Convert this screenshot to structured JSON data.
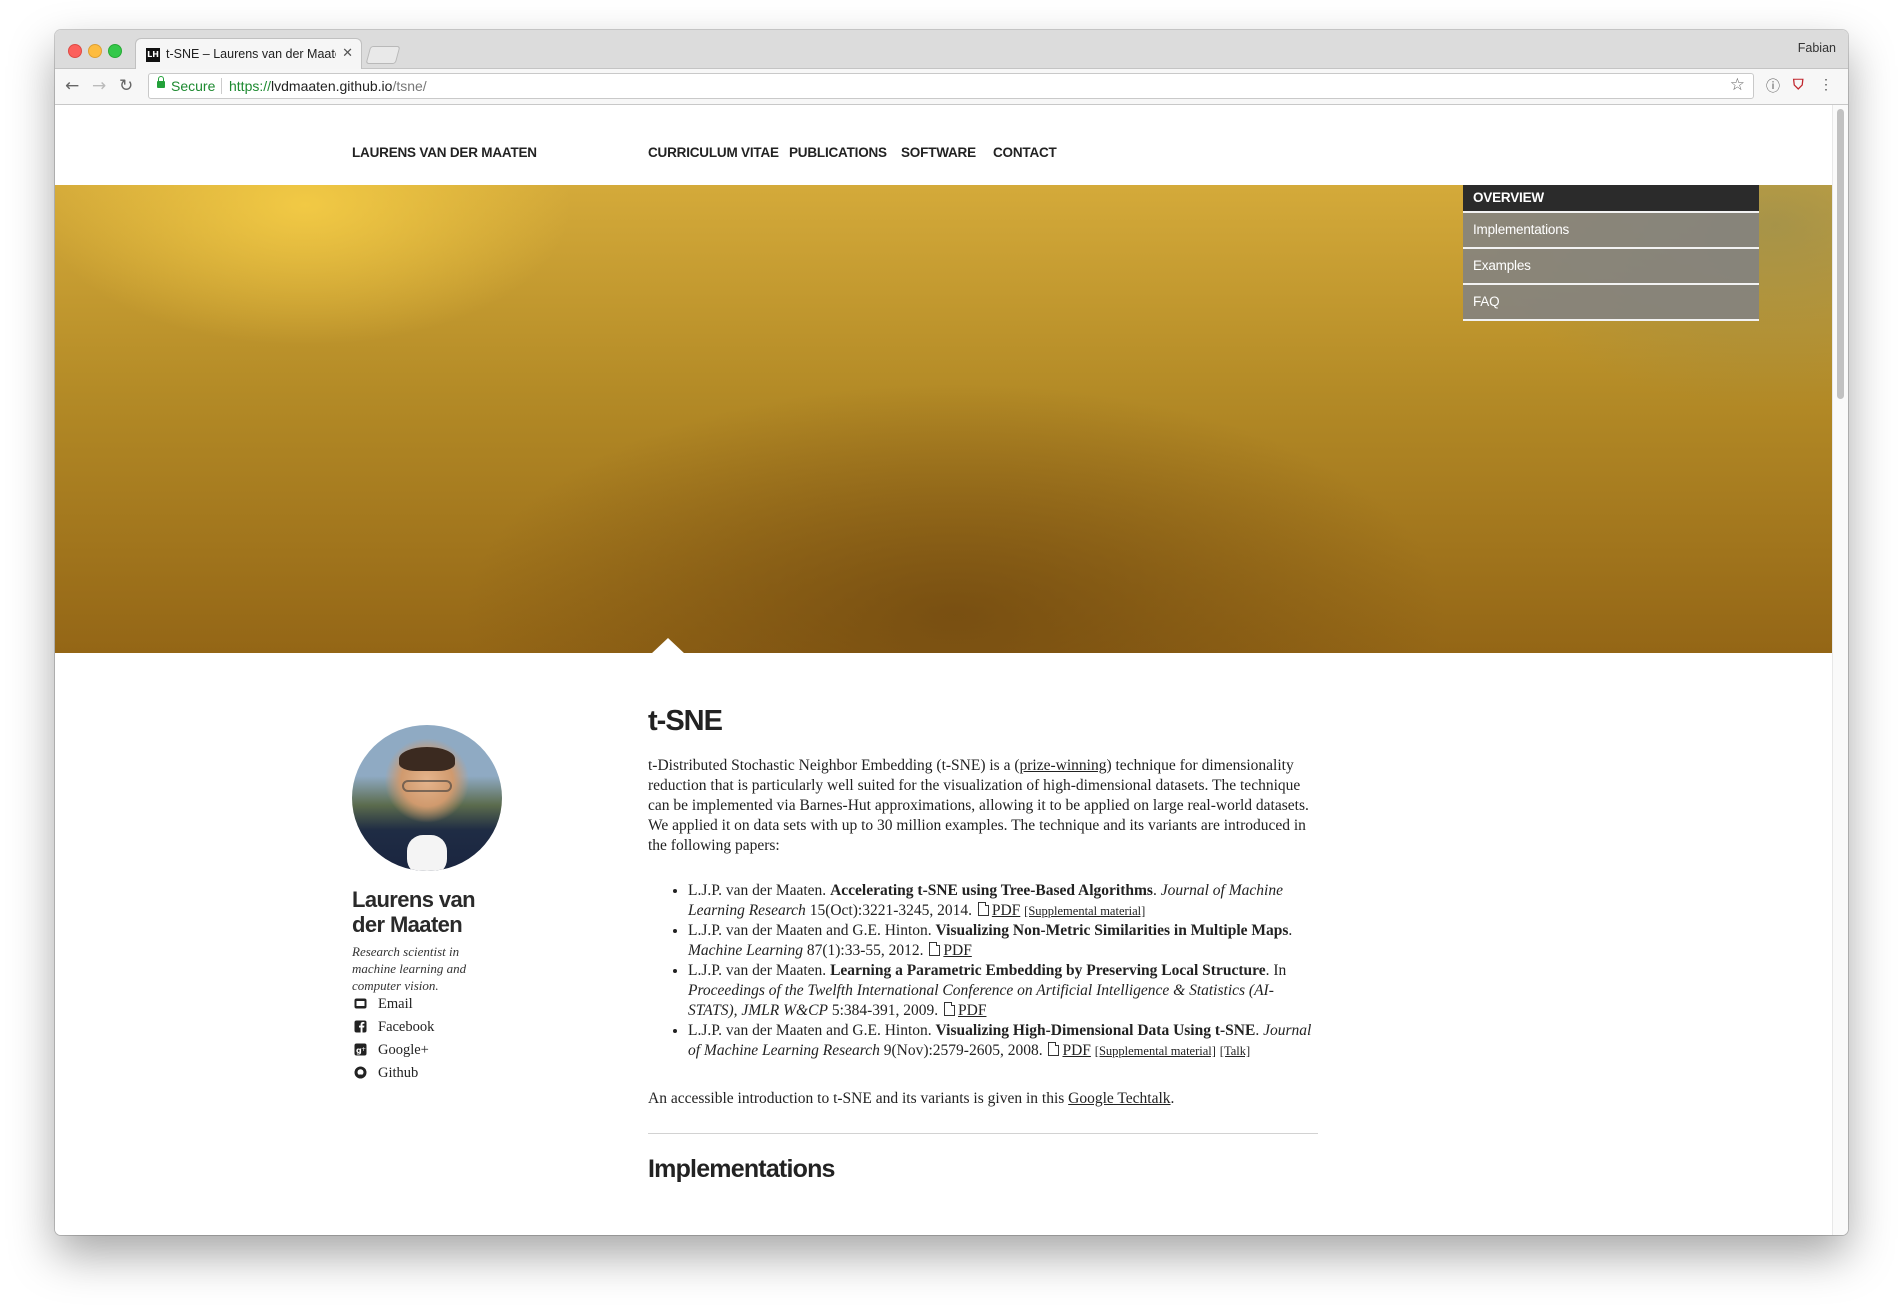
{
  "browser": {
    "tab_title": "t-SNE – Laurens van der Maaten",
    "favicon_text": "LH",
    "profile_name": "Fabian",
    "secure_label": "Secure",
    "url_scheme": "https://",
    "url_host": "lvdmaaten.github.io",
    "url_path": "/tsne/"
  },
  "site": {
    "brand": "LAURENS VAN DER MAATEN",
    "menu": [
      "CURRICULUM VITAE",
      "PUBLICATIONS",
      "SOFTWARE",
      "CONTACT"
    ]
  },
  "subnav": {
    "items": [
      "OVERVIEW",
      "Implementations",
      "Examples",
      "FAQ"
    ],
    "active": "OVERVIEW"
  },
  "profile": {
    "name": "Laurens van der Maaten",
    "bio": "Research scientist in machine learning and computer vision.",
    "links": [
      {
        "label": "Email",
        "icon": "envelope-icon"
      },
      {
        "label": "Facebook",
        "icon": "facebook-icon"
      },
      {
        "label": "Google+",
        "icon": "google-plus-icon"
      },
      {
        "label": "Github",
        "icon": "github-icon"
      }
    ]
  },
  "content": {
    "title": "t-SNE",
    "intro_before_link": "t-Distributed Stochastic Neighbor Embedding (t-SNE) is a (",
    "intro_link": "prize-winning",
    "intro_after_link": ") technique for dimensionality reduction that is particularly well suited for the visualization of high-dimensional datasets. The technique can be implemented via Barnes-Hut approximations, allowing it to be applied on large real-world datasets. We applied it on data sets with up to 30 million examples. The technique and its variants are introduced in the following papers:",
    "papers": [
      {
        "authors": "L.J.P. van der Maaten. ",
        "title": "Accelerating t-SNE using Tree-Based Algorithms",
        "venue_prefix": ". ",
        "venue": "Journal of Machine Learning Research",
        "details": " 15(Oct):3221-3245, 2014. ",
        "pdf": "PDF",
        "extra": [
          "[Supplemental material]"
        ]
      },
      {
        "authors": "L.J.P. van der Maaten and G.E. Hinton. ",
        "title": "Visualizing Non-Metric Similarities in Multiple Maps",
        "venue_prefix": ". ",
        "venue": "Machine Learning",
        "details": " 87(1):33-55, 2012. ",
        "pdf": "PDF",
        "extra": []
      },
      {
        "authors": "L.J.P. van der Maaten. ",
        "title": "Learning a Parametric Embedding by Preserving Local Structure",
        "venue_prefix": ". In ",
        "venue": "Proceedings of the Twelfth International Conference on Artificial Intelligence & Statistics (AI-STATS), JMLR W&CP",
        "details": " 5:384-391, 2009. ",
        "pdf": "PDF",
        "extra": []
      },
      {
        "authors": "L.J.P. van der Maaten and G.E. Hinton. ",
        "title": "Visualizing High-Dimensional Data Using t-SNE",
        "venue_prefix": ". ",
        "venue": "Journal of Machine Learning Research",
        "details": " 9(Nov):2579-2605, 2008. ",
        "pdf": "PDF",
        "extra": [
          "[Supplemental material]",
          "[Talk]"
        ]
      }
    ],
    "techtalk_before": "An accessible introduction to t-SNE and its variants is given in this ",
    "techtalk_link": "Google Techtalk",
    "techtalk_after": ".",
    "section2_title": "Implementations"
  }
}
